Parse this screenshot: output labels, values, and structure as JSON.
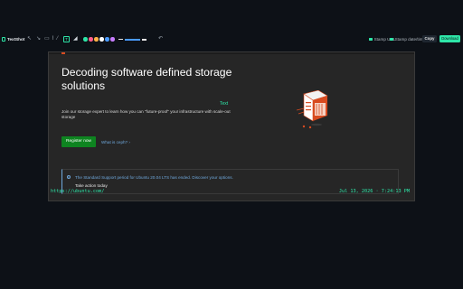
{
  "app": {
    "name": "TextShot"
  },
  "toolbar": {
    "tools": [
      {
        "name": "pointer",
        "glyph": "↖"
      },
      {
        "name": "arrow",
        "glyph": "↘"
      },
      {
        "name": "rectangle",
        "glyph": "▭"
      },
      {
        "name": "pen",
        "glyph": "⌇"
      },
      {
        "name": "line",
        "glyph": "⁄"
      }
    ],
    "active_tool_glyph": "T",
    "highlighter_glyph": "◢",
    "colors": [
      "#2ee6a8",
      "#ff5c8a",
      "#ffb347",
      "#ffffff",
      "#4a9bff",
      "#c77dff"
    ],
    "stamp_url_label": "Stamp URL",
    "stamp_date_label": "Stamp date/time",
    "copy_label": "Copy",
    "download_label": "Download"
  },
  "page": {
    "headline": "Decoding software defined storage solutions",
    "subtext": "Join our storage expert to learn how you can \"future-proof\" your infrastructure with scale-out storage",
    "annotation": "Text",
    "register_label": "Register now",
    "ceph_link": "What is ceph? ›",
    "notice": {
      "icon": "i",
      "text": "The Standard Support period for Ubuntu 20.04 LTS has ended. Discover your options.",
      "action": "Take action today"
    }
  },
  "stamp": {
    "url": "https://ubuntu.com/",
    "datetime": "Jul 13, 2026 · 7:24:13 PM"
  },
  "colors": {
    "accent": "#2ee6a8",
    "page_bg": "#0d1117",
    "shot_bg": "#262626",
    "register_green": "#0e8420",
    "link_blue": "#6fa8dc",
    "ubuntu_orange": "#d84b20"
  }
}
